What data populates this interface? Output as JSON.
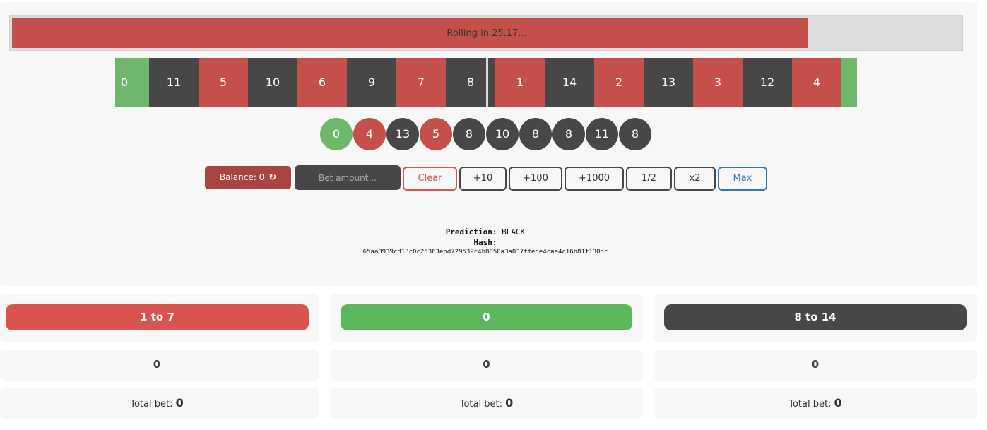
{
  "progress": {
    "label": "Rolling in 25.17...",
    "fraction": 0.84,
    "color": "#c5504b"
  },
  "reel": [
    {
      "n": "0",
      "c": "green",
      "w": 48
    },
    {
      "n": "11",
      "c": "black",
      "w": 70
    },
    {
      "n": "5",
      "c": "red",
      "w": 70
    },
    {
      "n": "10",
      "c": "black",
      "w": 70
    },
    {
      "n": "6",
      "c": "red",
      "w": 70
    },
    {
      "n": "9",
      "c": "black",
      "w": 70
    },
    {
      "n": "7",
      "c": "red",
      "w": 70
    },
    {
      "n": "8",
      "c": "black",
      "w": 70
    },
    {
      "n": "1",
      "c": "red",
      "w": 70
    },
    {
      "n": "14",
      "c": "black",
      "w": 70
    },
    {
      "n": "2",
      "c": "red",
      "w": 70
    },
    {
      "n": "13",
      "c": "black",
      "w": 70
    },
    {
      "n": "3",
      "c": "red",
      "w": 70
    },
    {
      "n": "12",
      "c": "black",
      "w": 70
    },
    {
      "n": "4",
      "c": "red",
      "w": 70
    },
    {
      "n": "",
      "c": "green",
      "w": 22
    }
  ],
  "history": [
    {
      "n": "0",
      "c": "green"
    },
    {
      "n": "4",
      "c": "red"
    },
    {
      "n": "13",
      "c": "black"
    },
    {
      "n": "5",
      "c": "red"
    },
    {
      "n": "8",
      "c": "black"
    },
    {
      "n": "10",
      "c": "black"
    },
    {
      "n": "8",
      "c": "black"
    },
    {
      "n": "8",
      "c": "black"
    },
    {
      "n": "11",
      "c": "black"
    },
    {
      "n": "8",
      "c": "black"
    }
  ],
  "controls": {
    "balance_label": "Balance: 0",
    "bet_placeholder": "Bet amount...",
    "clear": "Clear",
    "plus10": "+10",
    "plus100": "+100",
    "plus1000": "+1000",
    "half": "1/2",
    "double": "x2",
    "max": "Max"
  },
  "info": {
    "prediction_label": "Prediction:",
    "prediction_value": "BLACK",
    "hash_label": "Hash:",
    "hash_value": "65aa8939cd13c0c25363ebd729539c4b8050a3a037ffede4cae4c16b81f130dc"
  },
  "columns": [
    {
      "label": "1 to 7",
      "amount": "0",
      "total_label": "Total bet:",
      "total": "0",
      "color": "#d9534f"
    },
    {
      "label": "0",
      "amount": "0",
      "total_label": "Total bet:",
      "total": "0",
      "color": "#5cb85c"
    },
    {
      "label": "8 to 14",
      "amount": "0",
      "total_label": "Total bet:",
      "total": "0",
      "color": "#474747"
    }
  ],
  "colors": {
    "red": "#c5504b",
    "black": "#474747",
    "green": "#6db86b"
  }
}
